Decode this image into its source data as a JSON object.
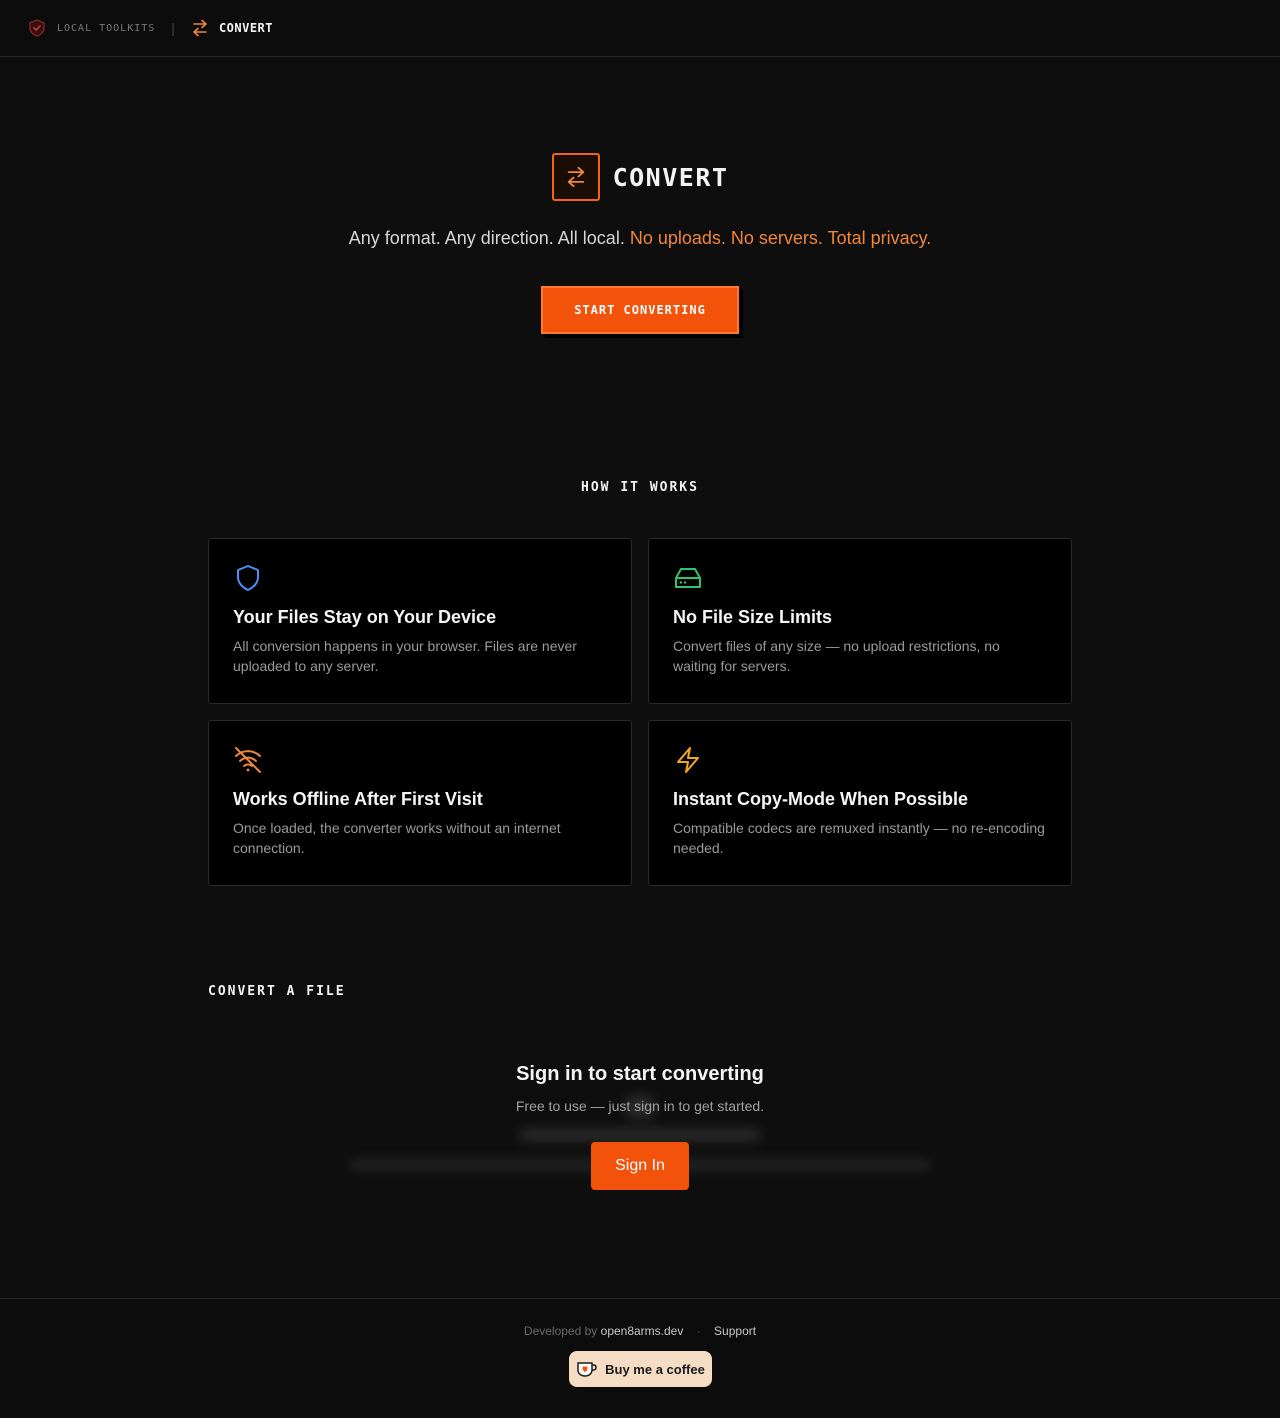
{
  "nav": {
    "brand_label": "LOCAL TOOLKITS",
    "separator": "|",
    "tool_label": "CONVERT"
  },
  "hero": {
    "title": "CONVERT",
    "subtitle_plain": "Any format. Any direction. All local. ",
    "subtitle_accent": "No uploads. No servers. Total privacy.",
    "cta_label": "START CONVERTING"
  },
  "how": {
    "title": "HOW IT WORKS",
    "cards": [
      {
        "icon": "shield-icon",
        "color": "#4f8ef7",
        "title": "Your Files Stay on Your Device",
        "desc": "All conversion happens in your browser. Files are never uploaded to any server."
      },
      {
        "icon": "hard-drive-icon",
        "color": "#2fc470",
        "title": "No File Size Limits",
        "desc": "Convert files of any size — no upload restrictions, no waiting for servers."
      },
      {
        "icon": "wifi-off-icon",
        "color": "#f2873a",
        "title": "Works Offline After First Visit",
        "desc": "Once loaded, the converter works without an internet connection."
      },
      {
        "icon": "zap-icon",
        "color": "#f2a81e",
        "title": "Instant Copy-Mode When Possible",
        "desc": "Compatible codecs are remuxed instantly — no re-encoding needed."
      }
    ]
  },
  "convert": {
    "title": "CONVERT A FILE",
    "signin_title": "Sign in to start converting",
    "signin_sub": "Free to use — just sign in to get started.",
    "signin_button": "Sign In"
  },
  "footer": {
    "developed_by": "Developed by",
    "developer": "open8arms.dev",
    "dot": "·",
    "support": "Support",
    "coffee_label": "Buy me a coffee"
  },
  "colors": {
    "accent": "#f2520a",
    "accent_text": "#f2873a"
  }
}
